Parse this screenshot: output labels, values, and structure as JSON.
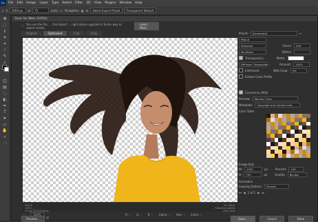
{
  "menubar": {
    "logo": "Ps",
    "items": [
      "File",
      "Edit",
      "Image",
      "Layer",
      "Type",
      "Select",
      "Filter",
      "3D",
      "View",
      "Plugins",
      "Window",
      "Help"
    ]
  },
  "options": {
    "size_value": "1000 px",
    "res_value": "72",
    "res_unit": "px/in",
    "straighten": "Straighten",
    "preset": "Select Export Preset",
    "transparent": "Transparent Default"
  },
  "dialog": {
    "title": "Save for Web (100%)",
    "notice": "You use the Pro, … the Export … right above upgrade is faster way to export assets.",
    "learn_more": "Learn More",
    "tabs": [
      "Original",
      "Optimized",
      "2-Up",
      "4-Up"
    ],
    "info_left": [
      "PNG-8",
      "100% … ",
      "20 sec @ 56.6 Kbps"
    ],
    "info_right": [
      "0% dither",
      "Selective palette",
      "256 colors"
    ],
    "zoom": "100%",
    "r_label": "R: --",
    "g_label": "G: --",
    "b_label": "B: --",
    "alpha_label": "Alpha: --",
    "hex_label": "Hex: --",
    "index_label": "Index: --"
  },
  "settings": {
    "preset_label": "Preset:",
    "preset_value": "[Unnamed]",
    "format": "PNG-8",
    "reduction": "Selective",
    "colors_label": "Colors:",
    "colors_value": "256",
    "dither_algo": "No Dither",
    "dither_label": "Dither:",
    "transparency": "Transparency",
    "matte_label": "Matte:",
    "trans_dither": "Diffusion Transparen…",
    "amount_label": "Amount:",
    "amount_value": "100%",
    "interlaced": "Interlaced",
    "web_snap_label": "Web Snap:",
    "web_snap_value": "0%",
    "embed": "Embed Color Profile",
    "convert": "Convert to sRGB",
    "preview_label": "Preview:",
    "preview_value": "Monitor Color",
    "metadata_label": "Metadata:",
    "metadata_value": "Copyright and Contact Info",
    "color_table": "Color Table",
    "image_size": "Image Size",
    "w_label": "W:",
    "w_value": "1000",
    "h_label": "H:",
    "h_value": "750",
    "unit": "px",
    "percent_label": "Percent:",
    "percent_value": "100",
    "quality_label": "Quality:",
    "quality_value": "Bicubic",
    "animation": "Animation",
    "looping_label": "Looping Options:",
    "looping_value": "Forever",
    "frame_counter": "1 of 1"
  },
  "buttons": {
    "preview": "Preview…",
    "save": "Save…",
    "cancel": "Cancel",
    "done": "Done"
  },
  "colors": {
    "shirt": "#f1b51c",
    "hair": "#2a1a12",
    "skin": "#c58d6c"
  }
}
